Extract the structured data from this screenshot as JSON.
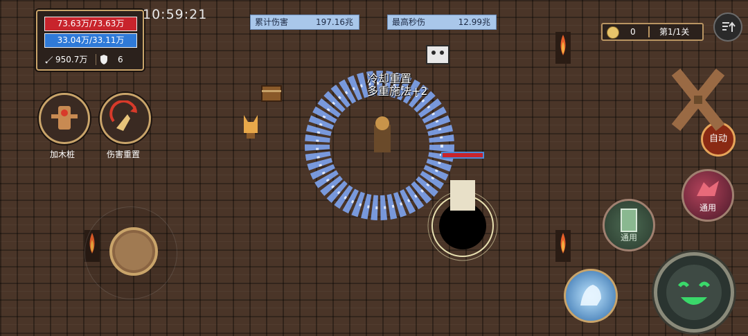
{
  "player": {
    "hp": "73.63万/73.63万",
    "mp": "33.04万/33.11万",
    "attack": "950.7万",
    "defense": "6"
  },
  "clock": "10:59:21",
  "damage": {
    "total_label": "累计伤害",
    "total_value": "197.16兆",
    "peak_label": "最高秒伤",
    "peak_value": "12.99兆"
  },
  "topright": {
    "gold": "0",
    "stage": "第1/1关",
    "menu_icon": "menu-arrow-icon"
  },
  "skills_left": [
    {
      "label": "加木桩",
      "icon": "training-dummy-icon"
    },
    {
      "label": "伤害重置",
      "icon": "broom-reset-icon"
    }
  ],
  "skills_right": [
    {
      "label": "通用",
      "icon": "wolf-skill-icon"
    },
    {
      "label": "通用",
      "icon": "scroll-skill-icon"
    },
    {
      "label": "",
      "icon": "ghost-horse-skill-icon"
    }
  ],
  "ultimate": {
    "icon": "smile-face-ultimate-icon"
  },
  "auto_button": "自动",
  "float_text": {
    "line1": "冷却重置",
    "line2": "多重施法+2"
  },
  "colors": {
    "hp": "#c8242c",
    "mp": "#2f7ad8",
    "accent": "#c9a46a",
    "floor": "#4a3528"
  }
}
